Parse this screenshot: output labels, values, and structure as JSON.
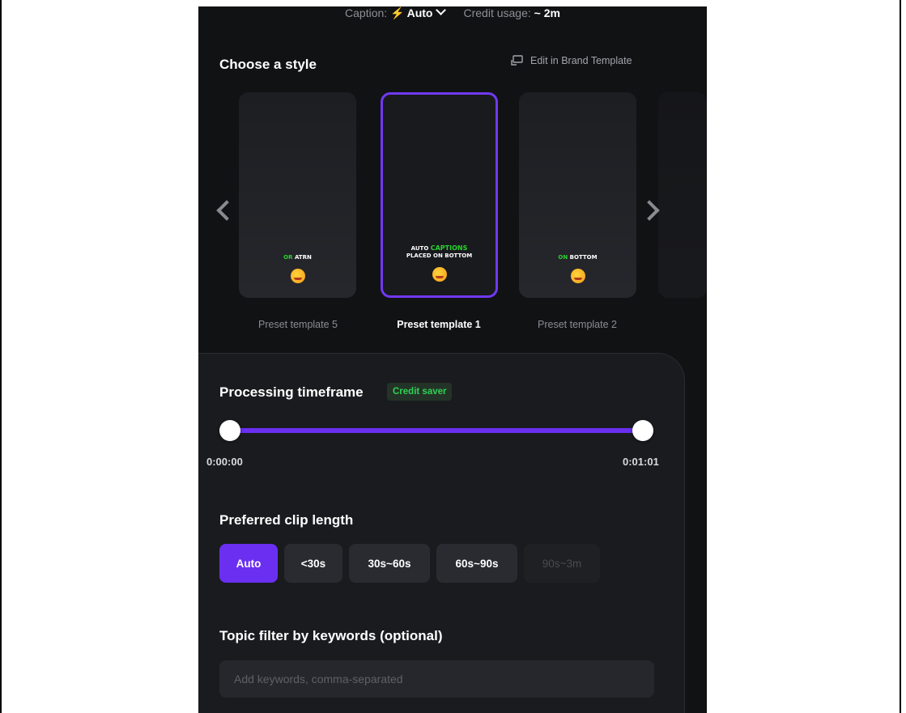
{
  "header": {
    "caption_label": "Caption:",
    "caption_value": "Auto",
    "credit_label": "Credit usage:",
    "credit_value": "~ 2m"
  },
  "style_section": {
    "title": "Choose a style",
    "edit_link": "Edit in Brand Template",
    "templates": [
      {
        "label": "Preset template 5",
        "caption_highlight": "OR",
        "caption_rest": "ATRN",
        "selected": false
      },
      {
        "label": "Preset template 1",
        "caption_line1_a": "AUTO",
        "caption_line1_b": "CAPTIONS",
        "caption_line2": "PLACED ON BOTTOM",
        "selected": true
      },
      {
        "label": "Preset template 2",
        "caption_highlight": "ON",
        "caption_rest": "BOTTOM",
        "selected": false
      }
    ]
  },
  "timeframe": {
    "title": "Processing timeframe",
    "badge": "Credit saver",
    "start": "0:00:00",
    "end": "0:01:01",
    "range_fraction": [
      0,
      1
    ]
  },
  "clip_length": {
    "title": "Preferred clip length",
    "options": [
      "Auto",
      "<30s",
      "30s~60s",
      "60s~90s",
      "90s~3m"
    ],
    "selected": "Auto"
  },
  "topic_filter": {
    "title": "Topic filter by keywords (optional)",
    "placeholder": "Add keywords, comma-separated"
  },
  "colors": {
    "accent": "#6a2ff0",
    "badge_text": "#2fd156",
    "background": "#111214"
  },
  "icons": {
    "caption_mode": "lightning-icon",
    "edit": "edit-template-icon"
  }
}
